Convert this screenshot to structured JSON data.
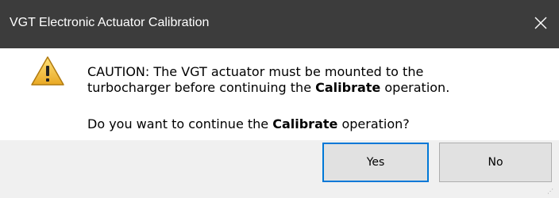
{
  "window": {
    "title": "VGT Electronic Actuator Calibration",
    "close_glyph": "✕"
  },
  "message": {
    "line1": "CAUTION:  The VGT actuator must be mounted to the",
    "line2_prefix": "turbocharger before continuing the ",
    "line2_bold": "Calibrate",
    "line2_suffix": " operation.",
    "line3_prefix": "Do you want to continue the ",
    "line3_bold": "Calibrate",
    "line3_suffix": " operation?"
  },
  "buttons": {
    "yes_label": "Yes",
    "no_label": "No"
  },
  "icons": {
    "warning": "warning-icon",
    "close": "close-icon"
  },
  "colors": {
    "titlebar": "#3c3c3c",
    "focus_border": "#0078d7",
    "warning_fill": "#f5c84a"
  }
}
